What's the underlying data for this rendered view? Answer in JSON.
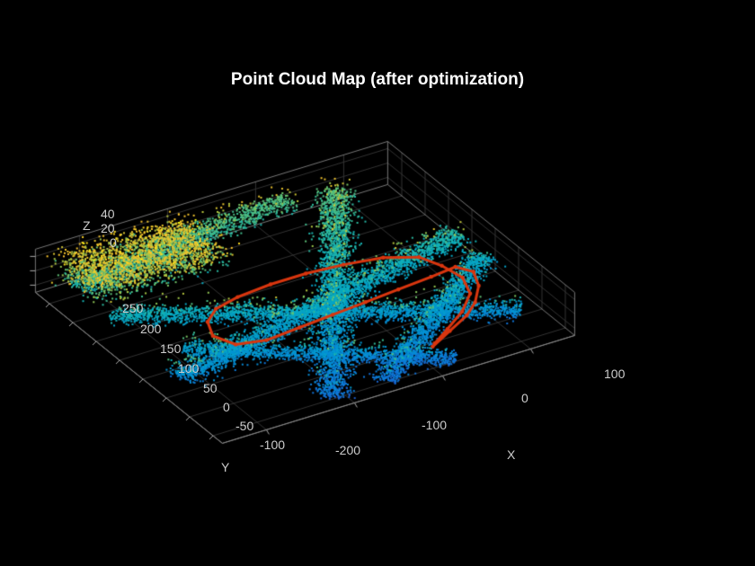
{
  "chart_data": {
    "type": "scatter",
    "title": "Point Cloud Map (after optimization)",
    "xlabel": "X",
    "ylabel": "Y",
    "zlabel": "Z",
    "x_ticks": [
      -200,
      -100,
      0,
      100
    ],
    "y_ticks": [
      -100,
      -50,
      0,
      50,
      100,
      150,
      200,
      250
    ],
    "z_ticks": [
      0,
      20,
      40
    ],
    "xlim": [
      -250,
      150
    ],
    "ylim": [
      -120,
      280
    ],
    "zlim": [
      -10,
      50
    ],
    "colormap": "parula",
    "trajectory_color": "#d9360f",
    "trajectory_path": [
      [
        10,
        -80
      ],
      [
        40,
        -60
      ],
      [
        70,
        -40
      ],
      [
        90,
        -20
      ],
      [
        110,
        10
      ],
      [
        120,
        40
      ],
      [
        110,
        60
      ],
      [
        80,
        55
      ],
      [
        40,
        50
      ],
      [
        0,
        45
      ],
      [
        -40,
        40
      ],
      [
        -80,
        35
      ],
      [
        -120,
        30
      ],
      [
        -150,
        40
      ],
      [
        -160,
        70
      ],
      [
        -150,
        100
      ],
      [
        -130,
        120
      ],
      [
        -100,
        130
      ],
      [
        -60,
        135
      ],
      [
        -20,
        135
      ],
      [
        20,
        130
      ],
      [
        60,
        120
      ],
      [
        90,
        100
      ],
      [
        100,
        70
      ],
      [
        105,
        35
      ],
      [
        95,
        0
      ],
      [
        70,
        -30
      ],
      [
        40,
        -55
      ],
      [
        15,
        -75
      ]
    ],
    "point_cloud_note": "Dense LIDAR point cloud of intersecting streets; color encodes height (parula colormap: blue low → yellow high)."
  }
}
